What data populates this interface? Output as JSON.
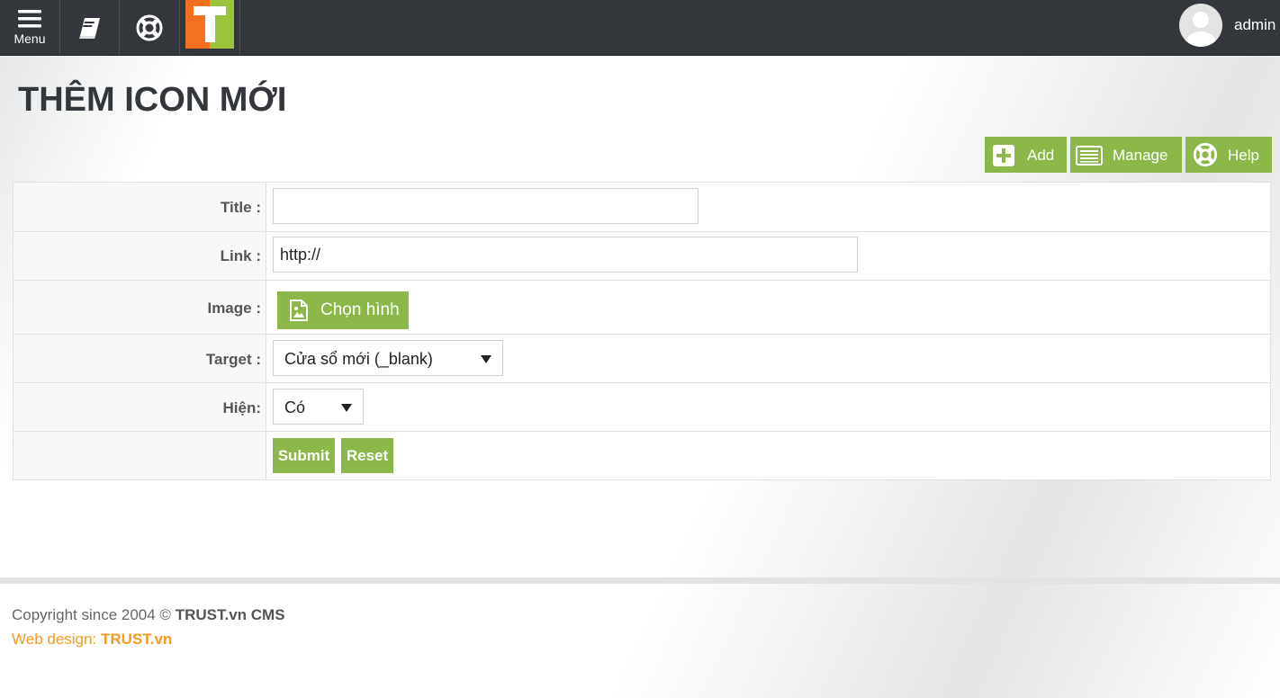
{
  "topbar": {
    "menu_label": "Menu",
    "logo_letter": "T",
    "username": "admin"
  },
  "page": {
    "title": "THÊM ICON MỚI"
  },
  "actions": {
    "add_label": "Add",
    "manage_label": "Manage",
    "help_label": "Help"
  },
  "form": {
    "title_label": "Title :",
    "title_value": "",
    "link_label": "Link :",
    "link_value": "http://",
    "image_label": "Image :",
    "image_button": "Chọn hình",
    "target_label": "Target :",
    "target_selected": "Cửa sổ mới (_blank)",
    "show_label": "Hiện:",
    "show_selected": "Có",
    "submit_label": "Submit",
    "reset_label": "Reset"
  },
  "footer": {
    "copyright_prefix": "Copyright since 2004 ©",
    "copyright_brand": "TRUST.vn CMS",
    "webdesign_prefix": "Web design:",
    "webdesign_brand": "TRUST.vn"
  },
  "colors": {
    "topbar_bg": "#33373c",
    "accent_green": "#8cb84a",
    "logo_orange": "#f37021",
    "logo_green": "#9bc33b",
    "footer_orange": "#f39a1f"
  },
  "icons": {
    "menu": "hamburger-icon",
    "book": "book-icon",
    "help": "lifebuoy-icon",
    "add": "plus-square-icon",
    "manage": "list-icon",
    "image": "image-file-icon"
  }
}
